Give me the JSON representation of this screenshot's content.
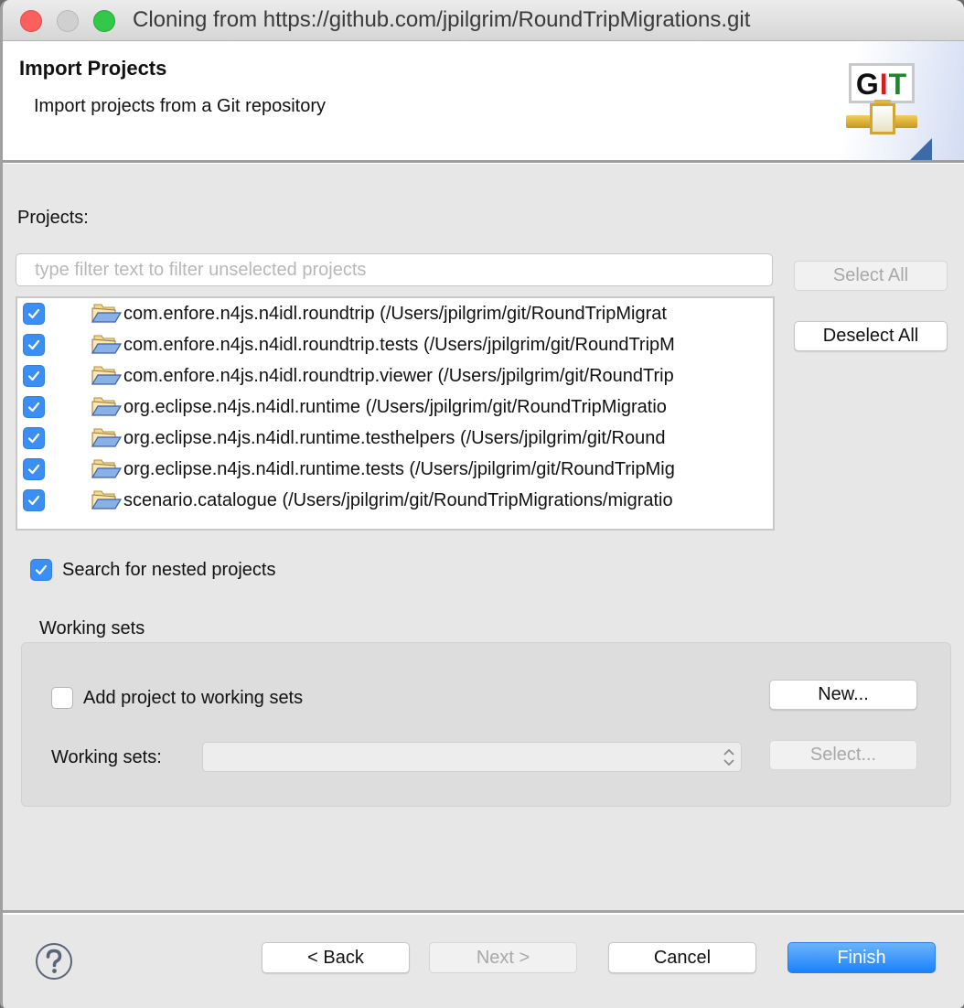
{
  "window": {
    "title": "Cloning from https://github.com/jpilgrim/RoundTripMigrations.git"
  },
  "banner": {
    "title": "Import Projects",
    "subtitle": "Import projects from a Git repository",
    "logo_icon": "git-logo-icon",
    "logo_letters": [
      "G",
      "I",
      "T"
    ]
  },
  "projects": {
    "label": "Projects:",
    "filter_placeholder": "type filter text to filter unselected projects",
    "filter_value": "",
    "items": [
      {
        "checked": true,
        "text": "com.enfore.n4js.n4idl.roundtrip (/Users/jpilgrim/git/RoundTripMigrat"
      },
      {
        "checked": true,
        "text": "com.enfore.n4js.n4idl.roundtrip.tests (/Users/jpilgrim/git/RoundTripM"
      },
      {
        "checked": true,
        "text": "com.enfore.n4js.n4idl.roundtrip.viewer (/Users/jpilgrim/git/RoundTrip"
      },
      {
        "checked": true,
        "text": "org.eclipse.n4js.n4idl.runtime (/Users/jpilgrim/git/RoundTripMigratio"
      },
      {
        "checked": true,
        "text": "org.eclipse.n4js.n4idl.runtime.testhelpers (/Users/jpilgrim/git/Round"
      },
      {
        "checked": true,
        "text": "org.eclipse.n4js.n4idl.runtime.tests (/Users/jpilgrim/git/RoundTripMig"
      },
      {
        "checked": true,
        "text": "scenario.catalogue (/Users/jpilgrim/git/RoundTripMigrations/migratio"
      }
    ],
    "select_all_label": "Select All",
    "select_all_enabled": false,
    "deselect_all_label": "Deselect All",
    "deselect_all_enabled": true
  },
  "nested": {
    "label": "Search for nested projects",
    "checked": true
  },
  "working_sets": {
    "group_title": "Working sets",
    "add_label": "Add project to working sets",
    "add_checked": false,
    "new_label": "New...",
    "sets_label": "Working sets:",
    "sets_value": "",
    "select_label": "Select...",
    "select_enabled": false
  },
  "footer": {
    "help_icon": "help-icon",
    "back_label": "< Back",
    "next_label": "Next >",
    "next_enabled": false,
    "cancel_label": "Cancel",
    "finish_label": "Finish"
  },
  "colors": {
    "accent": "#1a82fb",
    "checkbox_checked": "#3b8ff4",
    "close_button": "#fc605c",
    "maximize_button": "#34c84a",
    "git_i": "#d21e1e",
    "git_t": "#1d8a2a"
  }
}
